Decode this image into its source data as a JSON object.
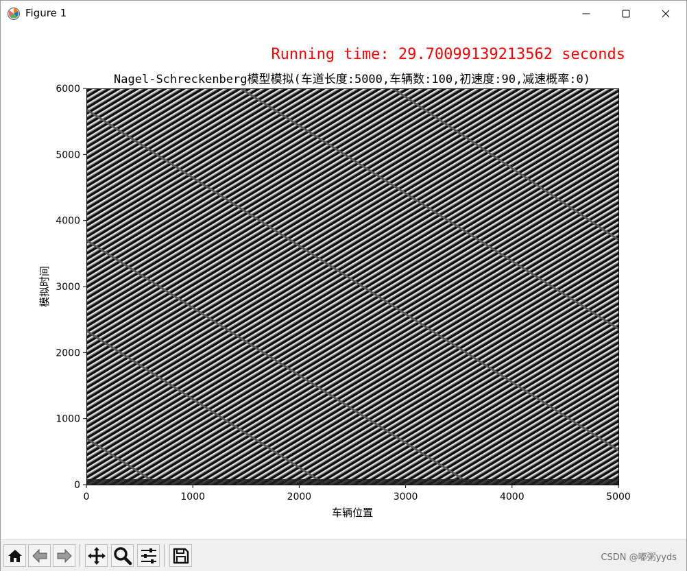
{
  "window": {
    "title": "Figure 1",
    "icon": "matplotlib-icon",
    "controls": [
      "minimize-icon",
      "maximize-icon",
      "close-icon"
    ]
  },
  "figure": {
    "runtime_label": "Running time: 29.70099139213562 seconds",
    "runtime_color": "#ff0000"
  },
  "toolbar": {
    "buttons": [
      "home-icon",
      "back-icon",
      "forward-icon",
      "pan-icon",
      "zoom-icon",
      "configure-subplots-icon",
      "save-icon"
    ]
  },
  "watermark": "CSDN @嘟粥yyds",
  "chart_data": {
    "type": "heatmap",
    "title": "Nagel-Schreckenberg模型模拟(车道长度:5000,车辆数:100,初速度:90,减速概率:0)",
    "xlabel": "车辆位置",
    "ylabel": "模拟时间",
    "xlim": [
      0,
      5000
    ],
    "ylim": [
      0,
      6000
    ],
    "xticks": [
      0,
      1000,
      2000,
      3000,
      4000,
      5000
    ],
    "yticks": [
      0,
      1000,
      2000,
      3000,
      4000,
      5000,
      6000
    ],
    "colormap": "gray",
    "grid": false,
    "description_free_params": {
      "vehicles": 100,
      "speed_per_step": 90,
      "road_length": 5000
    },
    "diagonal_band_boundaries": [
      {
        "x0": 0,
        "y0": 700,
        "x1": 600,
        "y1": 80
      },
      {
        "x0": 0,
        "y0": 2330,
        "x1": 2250,
        "y1": 0
      },
      {
        "x0": 0,
        "y0": 3700,
        "x1": 3620,
        "y1": 0
      },
      {
        "x0": 0,
        "y0": 5680,
        "x1": 5000,
        "y1": 520
      },
      {
        "x0": 1450,
        "y0": 6000,
        "x1": 5000,
        "y1": 2360
      },
      {
        "x0": 2880,
        "y0": 6000,
        "x1": 5000,
        "y1": 3710
      }
    ]
  }
}
